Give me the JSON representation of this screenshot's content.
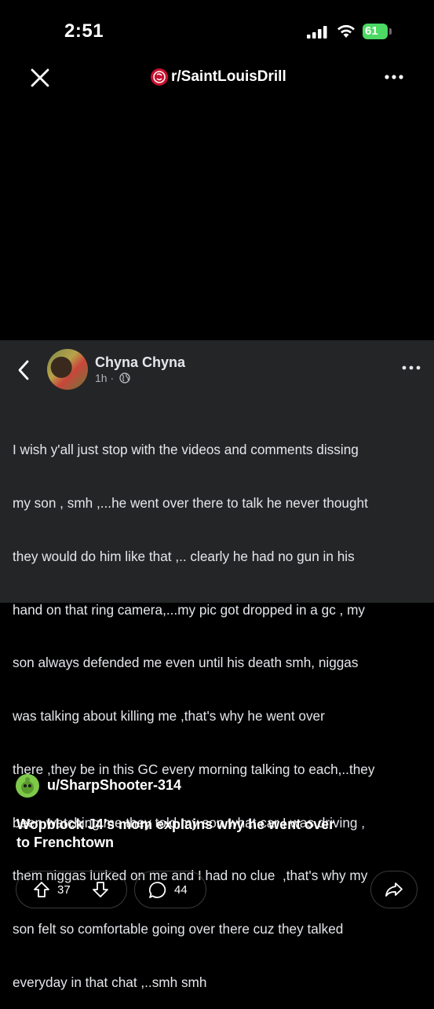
{
  "status_bar": {
    "time": "2:51",
    "battery": "61"
  },
  "header": {
    "subreddit": "r/SaintLouisDrill"
  },
  "facebook_post": {
    "author": "Chyna Chyna",
    "time": "1h ·",
    "lines": [
      "I wish y'all just stop with the videos and comments dissing",
      "my son , smh ,...he went over there to talk he never thought",
      "they would do him like that ,.. clearly he had no gun in his",
      "hand on that ring camera,...my pic got dropped in a gc , my",
      "son always defended me even until his death smh, niggas",
      "was talking about killing me ,that's why he went over",
      "there ,they be in this GC every morning talking to each,..they",
      "been watching me they told my son what car I was driving ,",
      "them niggas lurked on me and I had no clue  ,that's why my",
      "son felt so comfortable going over there cuz they talked",
      "everyday in that chat ,..smh smh"
    ]
  },
  "post": {
    "username": "u/SharpShooter-314",
    "title_lines": [
      "Wopblock J4’s mom explains why he went over",
      "to Frenchtown"
    ]
  },
  "actions": {
    "votes": "37",
    "comments": "44"
  },
  "colors": {
    "background": "#000000",
    "fb_card": "#242526",
    "battery": "#4cd964",
    "avatar": "#7ec94a"
  }
}
